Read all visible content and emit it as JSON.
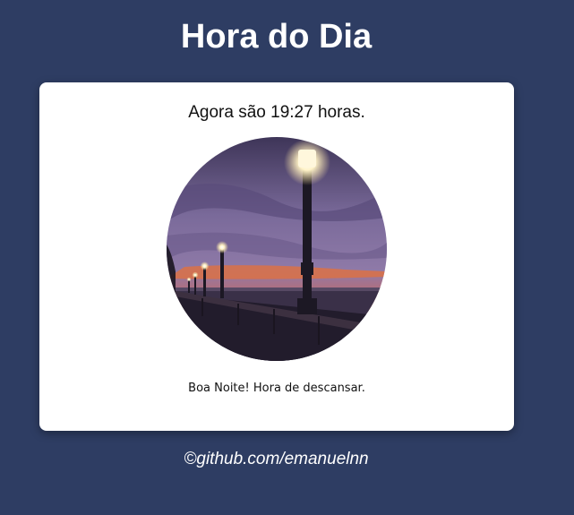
{
  "header": {
    "title": "Hora do Dia"
  },
  "card": {
    "time_text": "Agora são 19:27 horas.",
    "image": {
      "icon": "night-promenade-photo",
      "shape": "circle"
    },
    "greeting": "Boa Noite! Hora de descansar."
  },
  "footer": {
    "credit": "©github.com/emanuelnn"
  },
  "colors": {
    "background": "#2e3d63",
    "card": "#ffffff",
    "title": "#ffffff",
    "text": "#111111"
  }
}
